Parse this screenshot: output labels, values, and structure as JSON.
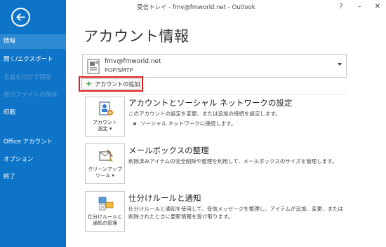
{
  "window": {
    "title": "受信トレイ - fmv@fmworld.net - Outlook",
    "help": "?",
    "minimize": "–",
    "close": "✕"
  },
  "sidebar": {
    "items": [
      {
        "label": "情報",
        "state": "active"
      },
      {
        "label": "開く/エクスポート",
        "state": "normal"
      },
      {
        "label": "名前を付けて保存",
        "state": "disabled"
      },
      {
        "label": "添付ファイルの保存",
        "state": "disabled"
      },
      {
        "label": "印刷",
        "state": "normal"
      },
      {
        "label": "Office アカウント",
        "state": "normal"
      },
      {
        "label": "オプション",
        "state": "normal"
      },
      {
        "label": "終了",
        "state": "normal"
      }
    ]
  },
  "main": {
    "title": "アカウント情報",
    "account": {
      "email": "fmv@fmworld.net",
      "type": "POP/SMTP"
    },
    "add_account_label": "アカウントの追加",
    "sections": [
      {
        "tile_label": "アカウント\n設定 ▾",
        "icon": "account-settings-icon",
        "title": "アカウントとソーシャル ネットワークの設定",
        "desc": "このアカウントの設定を変更、または追加の接続を設定します。",
        "bullet": "ソーシャル ネットワークに接続します。"
      },
      {
        "tile_label": "クリーンアップ\nツール ▾",
        "icon": "cleanup-tools-icon",
        "title": "メールボックスの整理",
        "desc": "削除済みアイテムの完全削除や整理を利用して、メールボックスのサイズを管理します。"
      },
      {
        "tile_label": "仕分けルールと\n通知の管理",
        "icon": "rules-alerts-icon",
        "title": "仕分けルールと通知",
        "desc": "仕分けルールと通知を使用して、受信メッセージを整理し、アイテムが追加、変更、または削除されたときに更新情報を受け取ります。"
      }
    ]
  },
  "colors": {
    "sidebar_bg": "#0e74c7",
    "sidebar_active": "#2f8ad4",
    "highlight": "#e31d1d",
    "plus": "#3a9a3a"
  }
}
